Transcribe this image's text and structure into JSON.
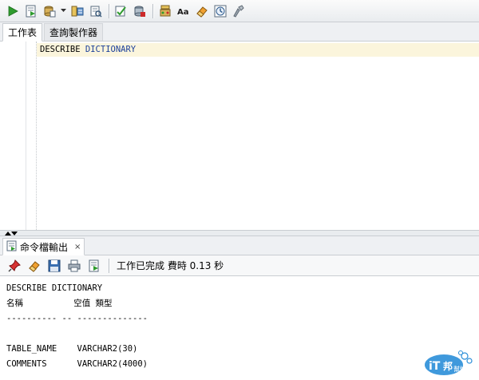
{
  "toolbar": {
    "icons": [
      "run-statement-icon",
      "run-script-icon",
      "commit-icon",
      "dropdown-icon",
      "explain-plan-icon",
      "autotrace-icon",
      "sql-tuning-icon",
      "clear-icon",
      "unshared-icon",
      "to-upper-icon",
      "eraser-icon",
      "history-icon",
      "format-icon"
    ]
  },
  "tabs": [
    {
      "label": "工作表",
      "active": true
    },
    {
      "label": "查詢製作器",
      "active": false
    }
  ],
  "editor": {
    "keyword": "DESCRIBE",
    "identifier": "DICTIONARY"
  },
  "output_panel": {
    "tab_label": "命令檔輸出",
    "close_label": "×",
    "status": "工作已完成 費時 0.13 秒",
    "lines": [
      "DESCRIBE DICTIONARY",
      "名稱          空值 類型",
      "---------- -- --------------",
      "TABLE_NAME    VARCHAR2(30)",
      "COMMENTS      VARCHAR2(4000)"
    ]
  },
  "watermark": {
    "text_main": "iT",
    "text_sub": "邦",
    "text_small": "幫忙"
  },
  "colors": {
    "run_green": "#2e9b2e",
    "identifier_blue": "#1b3f9a",
    "current_line": "#fbf5dc",
    "watermark_blue": "#2a8ed8"
  }
}
